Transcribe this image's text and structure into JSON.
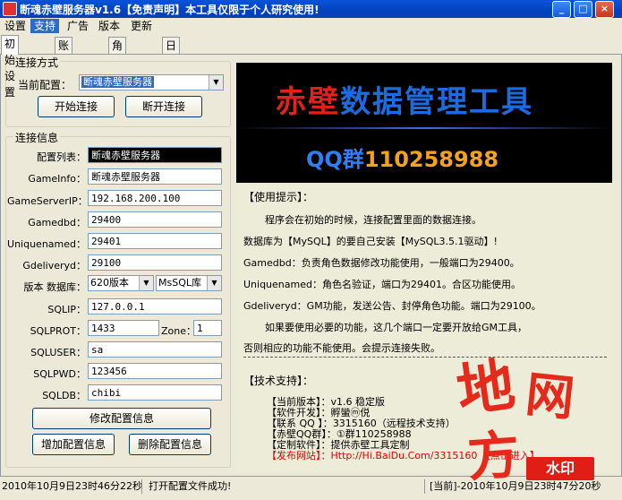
{
  "window": {
    "title": "断魂赤壁服务器v1.6【免责声明】本工具仅限于个人研究使用!",
    "controls": {
      "minimize": "_",
      "maximize": "□",
      "close": "×"
    }
  },
  "menu": {
    "items": [
      "设置",
      "支持",
      "广告",
      "版本",
      "更新"
    ],
    "active_index": 1
  },
  "tabs": [
    "初始设置",
    "账号管理",
    "角色管理",
    "日志更新"
  ],
  "connection": {
    "group_label": "连接方式",
    "current_config_label": "当前配置：",
    "current_config_value": "断魂赤壁服务器",
    "connect_button": "开始连接",
    "disconnect_button": "断开连接"
  },
  "conn_info": {
    "group_label": "连接信息",
    "fields": {
      "config_list": {
        "label": "配置列表：",
        "value": "断魂赤壁服务器"
      },
      "gameinfo": {
        "label": "GameInfo：",
        "value": "断魂赤壁服务器"
      },
      "gameserverip": {
        "label": "GameServerIP：",
        "value": "192.168.200.100"
      },
      "gamedbd": {
        "label": "Gamedbd：",
        "value": "29400"
      },
      "uniquenamed": {
        "label": "Uniquenamed：",
        "value": "29401"
      },
      "gdeliveryd": {
        "label": "Gdeliveryd：",
        "value": "29100"
      },
      "version_db": {
        "label": "版本 数据库：",
        "version": "620版本",
        "database": "MsSQL库"
      },
      "sqlip": {
        "label": "SQLIP：",
        "value": "127.0.0.1"
      },
      "sqlprot": {
        "label": "SQLPROT：",
        "value": "1433"
      },
      "zone": {
        "label": "Zone：",
        "value": "1"
      },
      "sqluser": {
        "label": "SQLUSER：",
        "value": "sa"
      },
      "sqlpwd": {
        "label": "SQLPWD：",
        "value": "123456"
      },
      "sqldb": {
        "label": "SQLDB：",
        "value": "chibi"
      }
    },
    "modify_button": "修改配置信息",
    "add_button": "增加配置信息",
    "delete_button": "删除配置信息"
  },
  "banner": {
    "title_red": "赤壁",
    "title_blue": "数据管理工具",
    "qq_prefix": "QQ群",
    "qq_number": "110258988"
  },
  "tips": {
    "heading": "【使用提示】：",
    "lines": [
      "程序会在初始的时候，连接配置里面的数据连接。",
      "数据库为【MySQL】的要自己安装【MySQL3.5.1驱动】!",
      "Gamedbd：负责角色数据修改功能使用，一般端口为29400。",
      "Uniquenamed：角色名验证，端口为29401。合区功能使用。",
      "Gdeliveryd：GM功能，发送公告、封停角色功能。端口为29100。",
      "如果要使用必要的功能，这几个端口一定要开放给GM工具，",
      "否则相应的功能不能使用。会提示连接失败。"
    ]
  },
  "support": {
    "heading": "【技术支持】：",
    "rows": [
      {
        "key": "【当前版本】：",
        "value": "v1.6 稳定版"
      },
      {
        "key": "【软件开发】：",
        "value": "孵蠻ⓜ侻"
      },
      {
        "key": "【联系 QQ 】：",
        "value": "3315160（远程技术支持）"
      },
      {
        "key": "【赤壁QQ群】：",
        "value": "①群110258988"
      },
      {
        "key": "【定制软件】：",
        "value": "提供赤壁工具定制"
      },
      {
        "key": "【发布网站】：",
        "value": "Http://Hi.BaiDu.Com/3315160 【点击进入】"
      }
    ]
  },
  "watermark": {
    "chars": [
      "地",
      "网",
      "方"
    ],
    "badge": "水印"
  },
  "status": {
    "left": "2010年10月9日23时46分22秒",
    "message": "打开配置文件成功!",
    "right": "[当前]-2010年10月9日23时47分20秒"
  },
  "colors": {
    "title_bar": "#0a53d8",
    "banner_red": "#e3211c",
    "banner_blue": "#1c6ce0",
    "qq_orange": "#f2a31c",
    "watermark_red": "#e52a1c"
  }
}
